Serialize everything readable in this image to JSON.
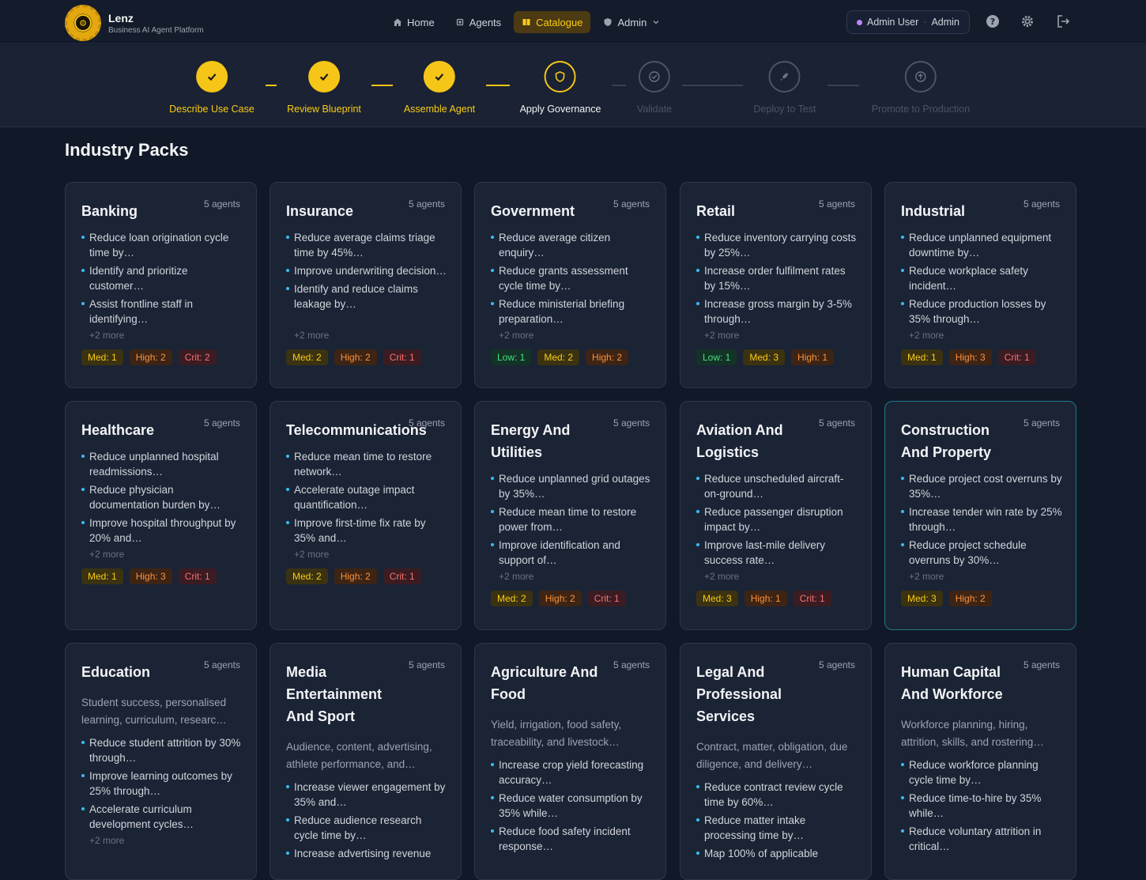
{
  "brand": {
    "name": "Lenz",
    "subtitle": "Business AI Agent Platform"
  },
  "nav": [
    {
      "label": "Home",
      "icon": "home-icon"
    },
    {
      "label": "Agents",
      "icon": "chip-icon"
    },
    {
      "label": "Catalogue",
      "icon": "book-icon",
      "active": true
    },
    {
      "label": "Admin",
      "icon": "shield-icon"
    }
  ],
  "user": {
    "name": "Admin User",
    "role": "Admin"
  },
  "steps": [
    {
      "label": "Describe Use Case",
      "state": "done"
    },
    {
      "label": "Review Blueprint",
      "state": "done"
    },
    {
      "label": "Assemble Agent",
      "state": "done"
    },
    {
      "label": "Apply Governance",
      "state": "current"
    },
    {
      "label": "Validate",
      "state": "future"
    },
    {
      "label": "Deploy to Test",
      "state": "future"
    },
    {
      "label": "Promote to Production",
      "state": "future"
    }
  ],
  "section_title": "Industry Packs",
  "colors": {
    "accent": "#f5c518",
    "bullet": "#38bdf8",
    "highlight_border": "#1f7a8c"
  },
  "cards": [
    {
      "title": "Banking",
      "count": "5 agents",
      "bullets": [
        "Reduce loan origination cycle time by…",
        "Identify and prioritize customer…",
        "Assist frontline staff in identifying…"
      ],
      "more": "+2 more",
      "badges": [
        {
          "t": "med",
          "label": "Med: 1"
        },
        {
          "t": "high",
          "label": "High: 2"
        },
        {
          "t": "crit",
          "label": "Crit: 2"
        }
      ]
    },
    {
      "title": "Insurance",
      "count": "5 agents",
      "bullets": [
        "Reduce average claims triage time by 45%…",
        "Improve underwriting decision…",
        "Identify and reduce claims leakage by…"
      ],
      "more": "+2 more",
      "badges": [
        {
          "t": "med",
          "label": "Med: 2"
        },
        {
          "t": "high",
          "label": "High: 2"
        },
        {
          "t": "crit",
          "label": "Crit: 1"
        }
      ]
    },
    {
      "title": "Government",
      "count": "5 agents",
      "bullets": [
        "Reduce average citizen enquiry…",
        "Reduce grants assessment cycle time by…",
        "Reduce ministerial briefing preparation…"
      ],
      "more": "+2 more",
      "badges": [
        {
          "t": "low",
          "label": "Low: 1"
        },
        {
          "t": "med",
          "label": "Med: 2"
        },
        {
          "t": "high",
          "label": "High: 2"
        }
      ]
    },
    {
      "title": "Retail",
      "count": "5 agents",
      "bullets": [
        "Reduce inventory carrying costs by 25%…",
        "Increase order fulfilment rates by 15%…",
        "Increase gross margin by 3-5% through…"
      ],
      "more": "+2 more",
      "badges": [
        {
          "t": "low",
          "label": "Low: 1"
        },
        {
          "t": "med",
          "label": "Med: 3"
        },
        {
          "t": "high",
          "label": "High: 1"
        }
      ]
    },
    {
      "title": "Industrial",
      "count": "5 agents",
      "bullets": [
        "Reduce unplanned equipment downtime by…",
        "Reduce workplace safety incident…",
        "Reduce production losses by 35% through…"
      ],
      "more": "+2 more",
      "badges": [
        {
          "t": "med",
          "label": "Med: 1"
        },
        {
          "t": "high",
          "label": "High: 3"
        },
        {
          "t": "crit",
          "label": "Crit: 1"
        }
      ]
    },
    {
      "title": "Healthcare",
      "count": "5 agents",
      "bullets": [
        "Reduce unplanned hospital readmissions…",
        "Reduce physician documentation burden by…",
        "Improve hospital throughput by 20% and…"
      ],
      "more": "+2 more",
      "badges": [
        {
          "t": "med",
          "label": "Med: 1"
        },
        {
          "t": "high",
          "label": "High: 3"
        },
        {
          "t": "crit",
          "label": "Crit: 1"
        }
      ]
    },
    {
      "title": "Telecommunications",
      "count": "5 agents",
      "bullets": [
        "Reduce mean time to restore network…",
        "Accelerate outage impact quantification…",
        "Improve first-time fix rate by 35% and…"
      ],
      "more": "+2 more",
      "badges": [
        {
          "t": "med",
          "label": "Med: 2"
        },
        {
          "t": "high",
          "label": "High: 2"
        },
        {
          "t": "crit",
          "label": "Crit: 1"
        }
      ]
    },
    {
      "title": "Energy And Utilities",
      "count": "5 agents",
      "bullets": [
        "Reduce unplanned grid outages by 35%…",
        "Reduce mean time to restore power from…",
        "Improve identification and support of…"
      ],
      "more": "+2 more",
      "badges": [
        {
          "t": "med",
          "label": "Med: 2"
        },
        {
          "t": "high",
          "label": "High: 2"
        },
        {
          "t": "crit",
          "label": "Crit: 1"
        }
      ]
    },
    {
      "title": "Aviation And Logistics",
      "count": "5 agents",
      "bullets": [
        "Reduce unscheduled aircraft-on-ground…",
        "Reduce passenger disruption impact by…",
        "Improve last-mile delivery success rate…"
      ],
      "more": "+2 more",
      "badges": [
        {
          "t": "med",
          "label": "Med: 3"
        },
        {
          "t": "high",
          "label": "High: 1"
        },
        {
          "t": "crit",
          "label": "Crit: 1"
        }
      ]
    },
    {
      "title": "Construction And Property",
      "count": "5 agents",
      "bullets": [
        "Reduce project cost overruns by 35%…",
        "Increase tender win rate by 25% through…",
        "Reduce project schedule overruns by 30%…"
      ],
      "more": "+2 more",
      "badges": [
        {
          "t": "med",
          "label": "Med: 3"
        },
        {
          "t": "high",
          "label": "High: 2"
        }
      ]
    },
    {
      "title": "Education",
      "count": "5 agents",
      "desc": "Student success, personalised learning, curriculum, researc…",
      "bullets": [
        "Reduce student attrition by 30% through…",
        "Improve learning outcomes by 25% through…",
        "Accelerate curriculum development cycles…"
      ],
      "more": "+2 more",
      "badges": []
    },
    {
      "title": "Media Entertainment And Sport",
      "count": "5 agents",
      "desc": "Audience, content, advertising, athlete performance, and…",
      "bullets": [
        "Increase viewer engagement by 35% and…",
        "Reduce audience research cycle time by…",
        "Increase advertising revenue"
      ],
      "more": "",
      "badges": []
    },
    {
      "title": "Agriculture And Food",
      "count": "5 agents",
      "desc": "Yield, irrigation, food safety, traceability, and livestock…",
      "bullets": [
        "Increase crop yield forecasting accuracy…",
        "Reduce water consumption by 35% while…",
        "Reduce food safety incident response…"
      ],
      "more": "",
      "badges": []
    },
    {
      "title": "Legal And Professional Services",
      "count": "5 agents",
      "desc": "Contract, matter, obligation, due diligence, and delivery…",
      "bullets": [
        "Reduce contract review cycle time by 60%…",
        "Reduce matter intake processing time by…",
        "Map 100% of applicable"
      ],
      "more": "",
      "badges": []
    },
    {
      "title": "Human Capital And Workforce",
      "count": "5 agents",
      "desc": "Workforce planning, hiring, attrition, skills, and rostering…",
      "bullets": [
        "Reduce workforce planning cycle time by…",
        "Reduce time-to-hire by 35% while…",
        "Reduce voluntary attrition in critical…"
      ],
      "more": "",
      "badges": []
    }
  ]
}
